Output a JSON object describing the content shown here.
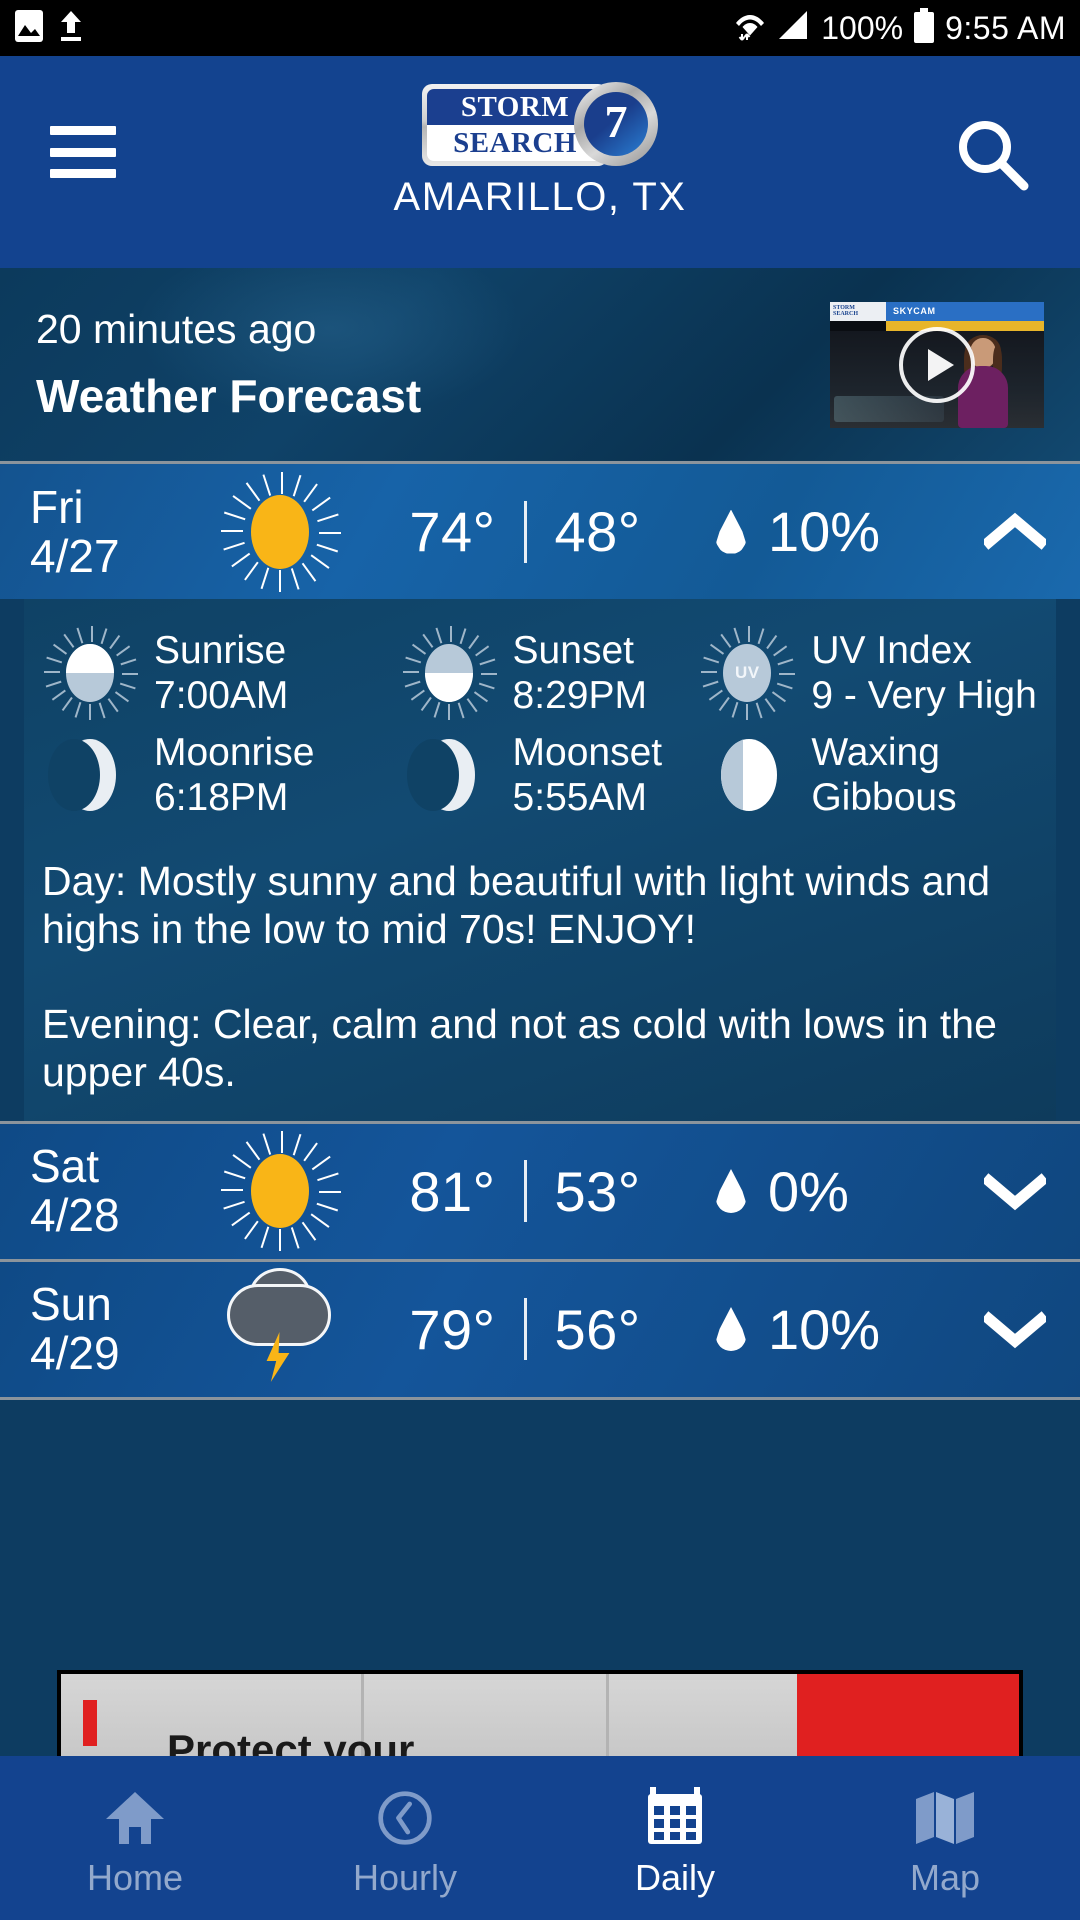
{
  "status_bar": {
    "icons": [
      "image-icon",
      "upload-icon",
      "wifi-icon",
      "signal-icon",
      "battery-icon"
    ],
    "battery_percent": "100%",
    "time": "9:55 AM"
  },
  "header": {
    "menu_icon": "hamburger-menu-icon",
    "search_icon": "search-icon",
    "logo": {
      "line1": "STORM",
      "line2": "SEARCH",
      "badge": "7"
    },
    "location": "AMARILLO, TX"
  },
  "promo": {
    "timestamp": "20 minutes ago",
    "title": "Weather Forecast",
    "thumbnail": {
      "station_line1": "STORM",
      "station_line2": "SEARCH",
      "banner": "SKYCAM",
      "play_icon": "play-icon"
    }
  },
  "forecast": {
    "days": [
      {
        "day": "Fri",
        "date": "4/27",
        "icon": "sunny-icon",
        "high": "74°",
        "low": "48°",
        "precip_icon": "water-drop-icon",
        "precip": "10%",
        "chevron": "chevron-up-icon",
        "expanded": true,
        "details": {
          "astro": [
            {
              "label": "Sunrise",
              "value": "7:00AM",
              "icon": "sunrise-icon"
            },
            {
              "label": "Sunset",
              "value": "8:29PM",
              "icon": "sunset-icon"
            },
            {
              "label": "UV Index",
              "value": "9 - Very High",
              "icon": "uv-index-icon",
              "badge": "UV"
            },
            {
              "label": "Moonrise",
              "value": "6:18PM",
              "icon": "moonrise-icon"
            },
            {
              "label": "Moonset",
              "value": "5:55AM",
              "icon": "moonset-icon"
            },
            {
              "label": "Waxing",
              "value": "Gibbous",
              "icon": "moon-phase-icon"
            }
          ],
          "day_forecast": "Day: Mostly sunny and beautiful with light winds and highs in the low to mid 70s! ENJOY!",
          "evening_forecast": "Evening: Clear, calm and not as cold with lows in the upper 40s."
        }
      },
      {
        "day": "Sat",
        "date": "4/28",
        "icon": "sunny-icon",
        "high": "81°",
        "low": "53°",
        "precip_icon": "water-drop-icon",
        "precip": "0%",
        "chevron": "chevron-down-icon",
        "expanded": false
      },
      {
        "day": "Sun",
        "date": "4/29",
        "icon": "thunderstorm-icon",
        "high": "79°",
        "low": "56°",
        "precip_icon": "water-drop-icon",
        "precip": "10%",
        "chevron": "chevron-down-icon",
        "expanded": false
      }
    ]
  },
  "ad": {
    "headline": "Protect your"
  },
  "bottom_nav": {
    "items": [
      {
        "label": "Home",
        "icon": "home-icon",
        "active": false
      },
      {
        "label": "Hourly",
        "icon": "clock-icon",
        "active": false
      },
      {
        "label": "Daily",
        "icon": "calendar-icon",
        "active": true
      },
      {
        "label": "Map",
        "icon": "map-icon",
        "active": false
      }
    ]
  },
  "colors": {
    "header_blue": "#13438f",
    "row_blue": "#10477f",
    "detail_navy": "#0f4265",
    "sun_yellow": "#F9B517",
    "cloud_gray": "#555e69",
    "nav_inactive": "#93a9cc"
  }
}
